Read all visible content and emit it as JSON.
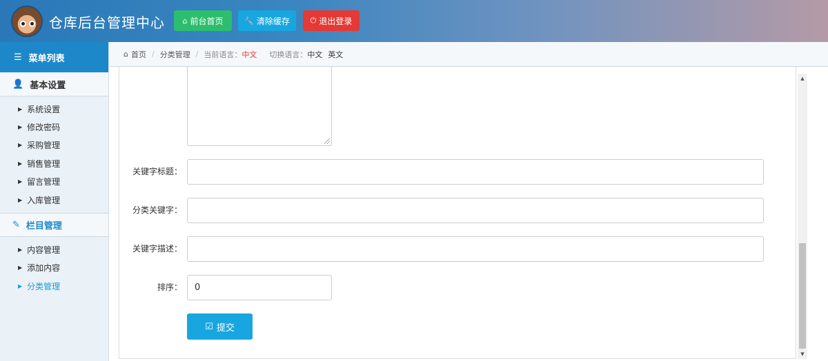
{
  "header": {
    "title": "仓库后台管理中心",
    "buttons": {
      "home": {
        "icon": "home-icon",
        "label": "前台首页"
      },
      "clear_cache": {
        "icon": "wrench-icon",
        "label": "清除缓存"
      },
      "logout": {
        "icon": "power-icon",
        "label": "退出登录"
      }
    },
    "colors": {
      "home": "#2dbd6e",
      "clear_cache": "#18a6e0",
      "logout": "#e53935"
    }
  },
  "sidebar": {
    "menu_title": "菜单列表",
    "groups": [
      {
        "icon": "user-icon",
        "title": "基本设置",
        "items": [
          "系统设置",
          "修改密码",
          "采购管理",
          "销售管理",
          "留言管理",
          "入库管理"
        ]
      },
      {
        "icon": "edit-icon",
        "title": "栏目管理",
        "items": [
          "内容管理",
          "添加内容",
          "分类管理"
        ],
        "active": "分类管理"
      }
    ]
  },
  "breadcrumb": {
    "home": "首页",
    "section": "分类管理",
    "current_lang_label": "当前语言：",
    "current_lang": "中文",
    "switch_label": "切换语言：",
    "lang_options": [
      "中文",
      "英文"
    ]
  },
  "form": {
    "fields": [
      {
        "label": "关键字标题：",
        "value": ""
      },
      {
        "label": "分类关键字：",
        "value": ""
      },
      {
        "label": "关键字描述：",
        "value": ""
      },
      {
        "label": "排序：",
        "value": "0"
      }
    ],
    "submit_label": "提交"
  }
}
